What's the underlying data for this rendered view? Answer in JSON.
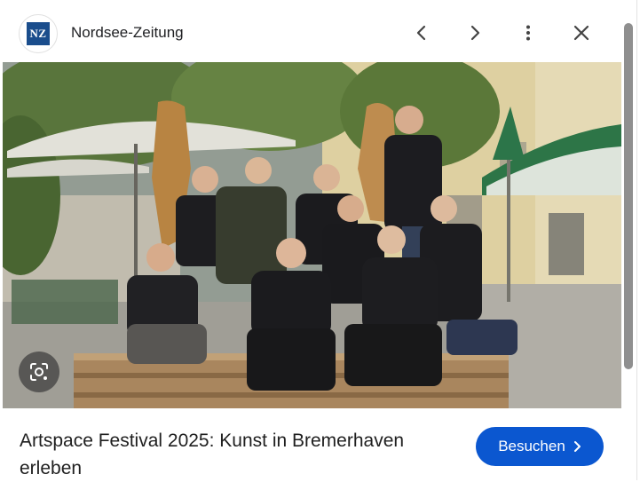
{
  "header": {
    "source_logo_text": "NZ",
    "source_name": "Nordsee-Zeitung",
    "icons": [
      "chevron-left-icon",
      "chevron-right-icon",
      "more-vert-icon",
      "close-icon"
    ]
  },
  "image": {
    "lens_icon": "google-lens-icon"
  },
  "result": {
    "title": "Artspace Festival 2025: Kunst in Bremerhaven erleben",
    "visit_label": "Besuchen"
  },
  "colors": {
    "accent": "#0b57d0",
    "logo_bg": "#1a4d8c"
  }
}
